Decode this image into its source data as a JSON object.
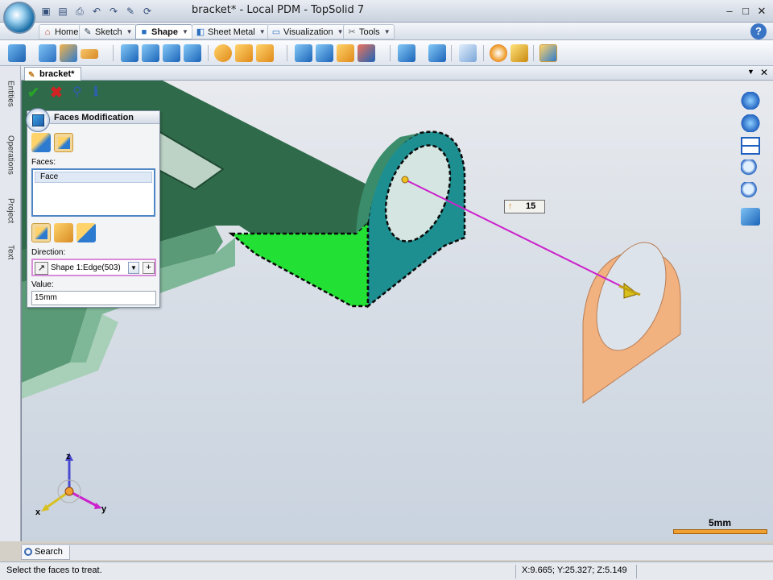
{
  "window": {
    "title": "bracket* - Local PDM - TopSolid 7"
  },
  "ribbon_tabs": [
    {
      "label": "Home",
      "icon": "home-icon"
    },
    {
      "label": "Sketch",
      "icon": "pencil-icon"
    },
    {
      "label": "Shape",
      "icon": "cube-icon",
      "active": true
    },
    {
      "label": "Sheet Metal",
      "icon": "sheet-metal-icon"
    },
    {
      "label": "Visualization",
      "icon": "monitor-icon"
    },
    {
      "label": "Tools",
      "icon": "tools-icon"
    }
  ],
  "document": {
    "tab_label": "bracket*"
  },
  "side_tabs": [
    "Entities",
    "Operations",
    "Project",
    "Text"
  ],
  "panel": {
    "title": "Faces Modification",
    "faces_label": "Faces:",
    "faces_items": [
      "Face"
    ],
    "direction_label": "Direction:",
    "direction_value": "Shape 1:Edge(503)",
    "value_label": "Value:",
    "value": "15mm"
  },
  "dimension_label": "15",
  "axes": {
    "x": "x",
    "y": "y",
    "z": "z"
  },
  "scale": {
    "label": "5mm"
  },
  "search_tab": "Search",
  "status": {
    "message": "Select the faces to treat.",
    "coordinates": "X:9.665; Y:25.327; Z:5.149"
  },
  "colors": {
    "model_green": "#2e6b48",
    "selected_face_teal": "#1e8f91",
    "highlight_green": "#22e034",
    "preview_orange": "#f2b27f",
    "direction_magenta": "#cc22cc",
    "scale_orange": "#f0a030"
  }
}
